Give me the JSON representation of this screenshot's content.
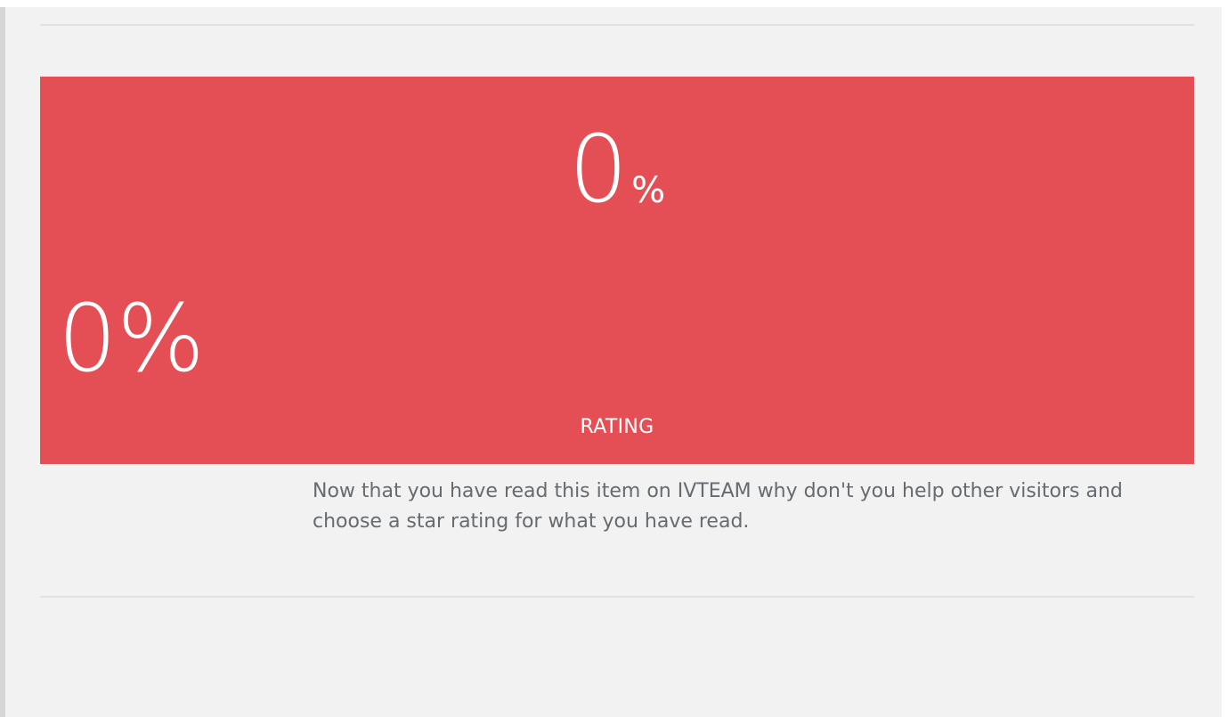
{
  "rating": {
    "score_value": "0",
    "score_unit": "%",
    "score_full": "0%",
    "label": "RATING",
    "percent": 0
  },
  "prompt": {
    "text": "Now that you have read this item on IVTEAM why don't you help other visitors and choose a star rating for what you have read."
  },
  "colors": {
    "rating_background": "#e44f55",
    "page_background": "#f2f2f2",
    "prompt_text": "#666b70"
  }
}
